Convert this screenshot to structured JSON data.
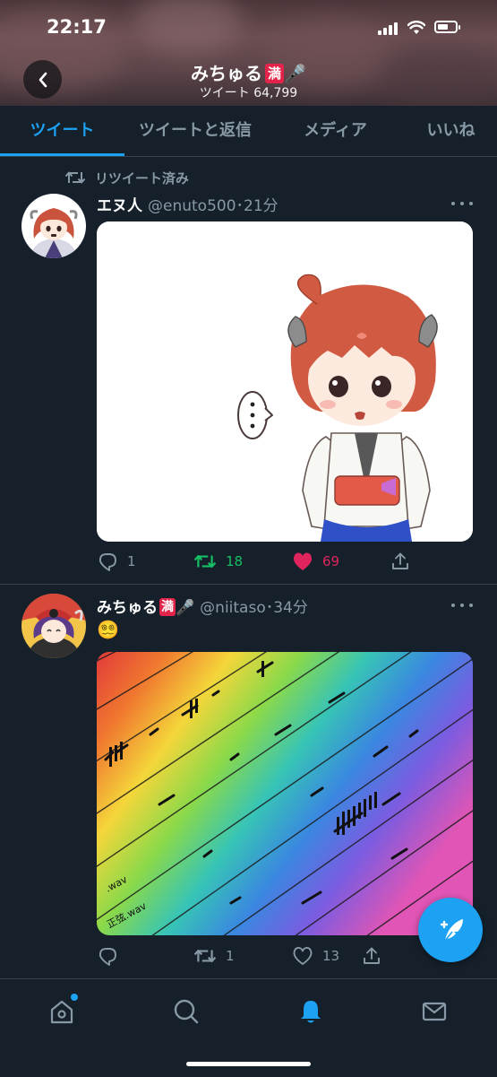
{
  "status": {
    "time": "22:17"
  },
  "header": {
    "name": "みちゅる",
    "name_badge": "満",
    "name_emoji": "🎤",
    "tweet_count": "ツイート 64,799"
  },
  "tabs": [
    {
      "label": "ツイート",
      "active": true
    },
    {
      "label": "ツイートと返信",
      "active": false
    },
    {
      "label": "メディア",
      "active": false
    },
    {
      "label": "いいね",
      "active": false
    }
  ],
  "tweets": [
    {
      "retweet_label": "リツイート済み",
      "name": "エヌ人",
      "handle_time": "@enuto500･21分",
      "replies": "1",
      "retweets": "18",
      "likes": "69",
      "retweeted": true,
      "liked": true
    },
    {
      "name": "みちゅる",
      "name_badge": "満",
      "name_emoji": "🎤",
      "handle_time": "@niitaso･34分",
      "text": "😵‍💫",
      "media_label_1": "正弦.wav",
      "media_label_2": ".wav",
      "replies": "",
      "retweets": "1",
      "likes": "13",
      "retweeted": false,
      "liked": false
    }
  ],
  "icons": {
    "back": "chevron-left-icon",
    "reply": "reply-icon",
    "retweet": "retweet-icon",
    "like": "heart-icon",
    "share": "share-icon",
    "compose": "compose-feather-icon",
    "home": "home-icon",
    "search": "search-icon",
    "notifications": "bell-icon",
    "messages": "mail-icon"
  },
  "colors": {
    "background": "#15202b",
    "accent": "#1da1f2",
    "retweet_green": "#17bf63",
    "like_pink": "#e0245e",
    "muted": "#8899a6",
    "divider": "#38444d"
  }
}
